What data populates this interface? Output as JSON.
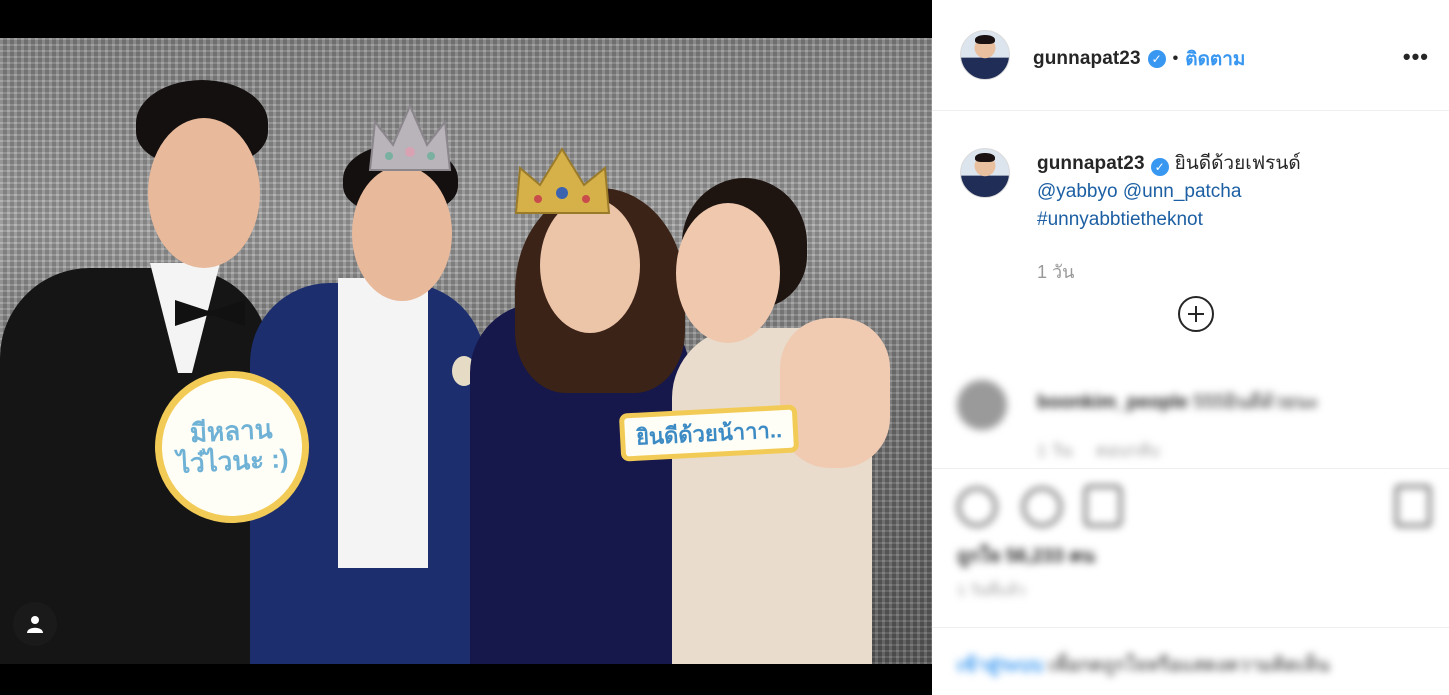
{
  "post": {
    "username": "gunnapat23",
    "verified": true,
    "follow_label": "ติดตาม",
    "more_icon": "more-horizontal-icon",
    "dot": "•"
  },
  "photo": {
    "sign_round_text": "มีหลาน\nไว๋ไวนะ :)",
    "sign_rect_text": "ยินดีด้วยน้าาา..",
    "user_tag_icon": "user-icon"
  },
  "caption": {
    "username": "gunnapat23",
    "text": "ยินดีด้วยเฟรนด์",
    "mentions": [
      "@yabbyo",
      "@unn_patcha"
    ],
    "hashtag": "#unnyabbtietheknot",
    "time": "1 วัน",
    "load_more_icon": "plus-circle-icon"
  },
  "blurred": {
    "comment_user": "boonkim_people",
    "comment_text": "555ยินดีด้วยนะ",
    "comment_time": "1 วัน",
    "comment_reply": "ตอบกลับ",
    "likes": "ถูกใจ 56,233 คน",
    "ago": "1 วันที่แล้ว",
    "login_link": "เข้าสู่ระบบ",
    "login_text": "เพื่อกดถูกใจหรือแสดงความคิดเห็น"
  },
  "colors": {
    "accent_blue": "#3897f0",
    "link_blue": "#1c5fa3",
    "text": "#262626",
    "muted": "#999999",
    "sign_border": "#f2cb57"
  }
}
